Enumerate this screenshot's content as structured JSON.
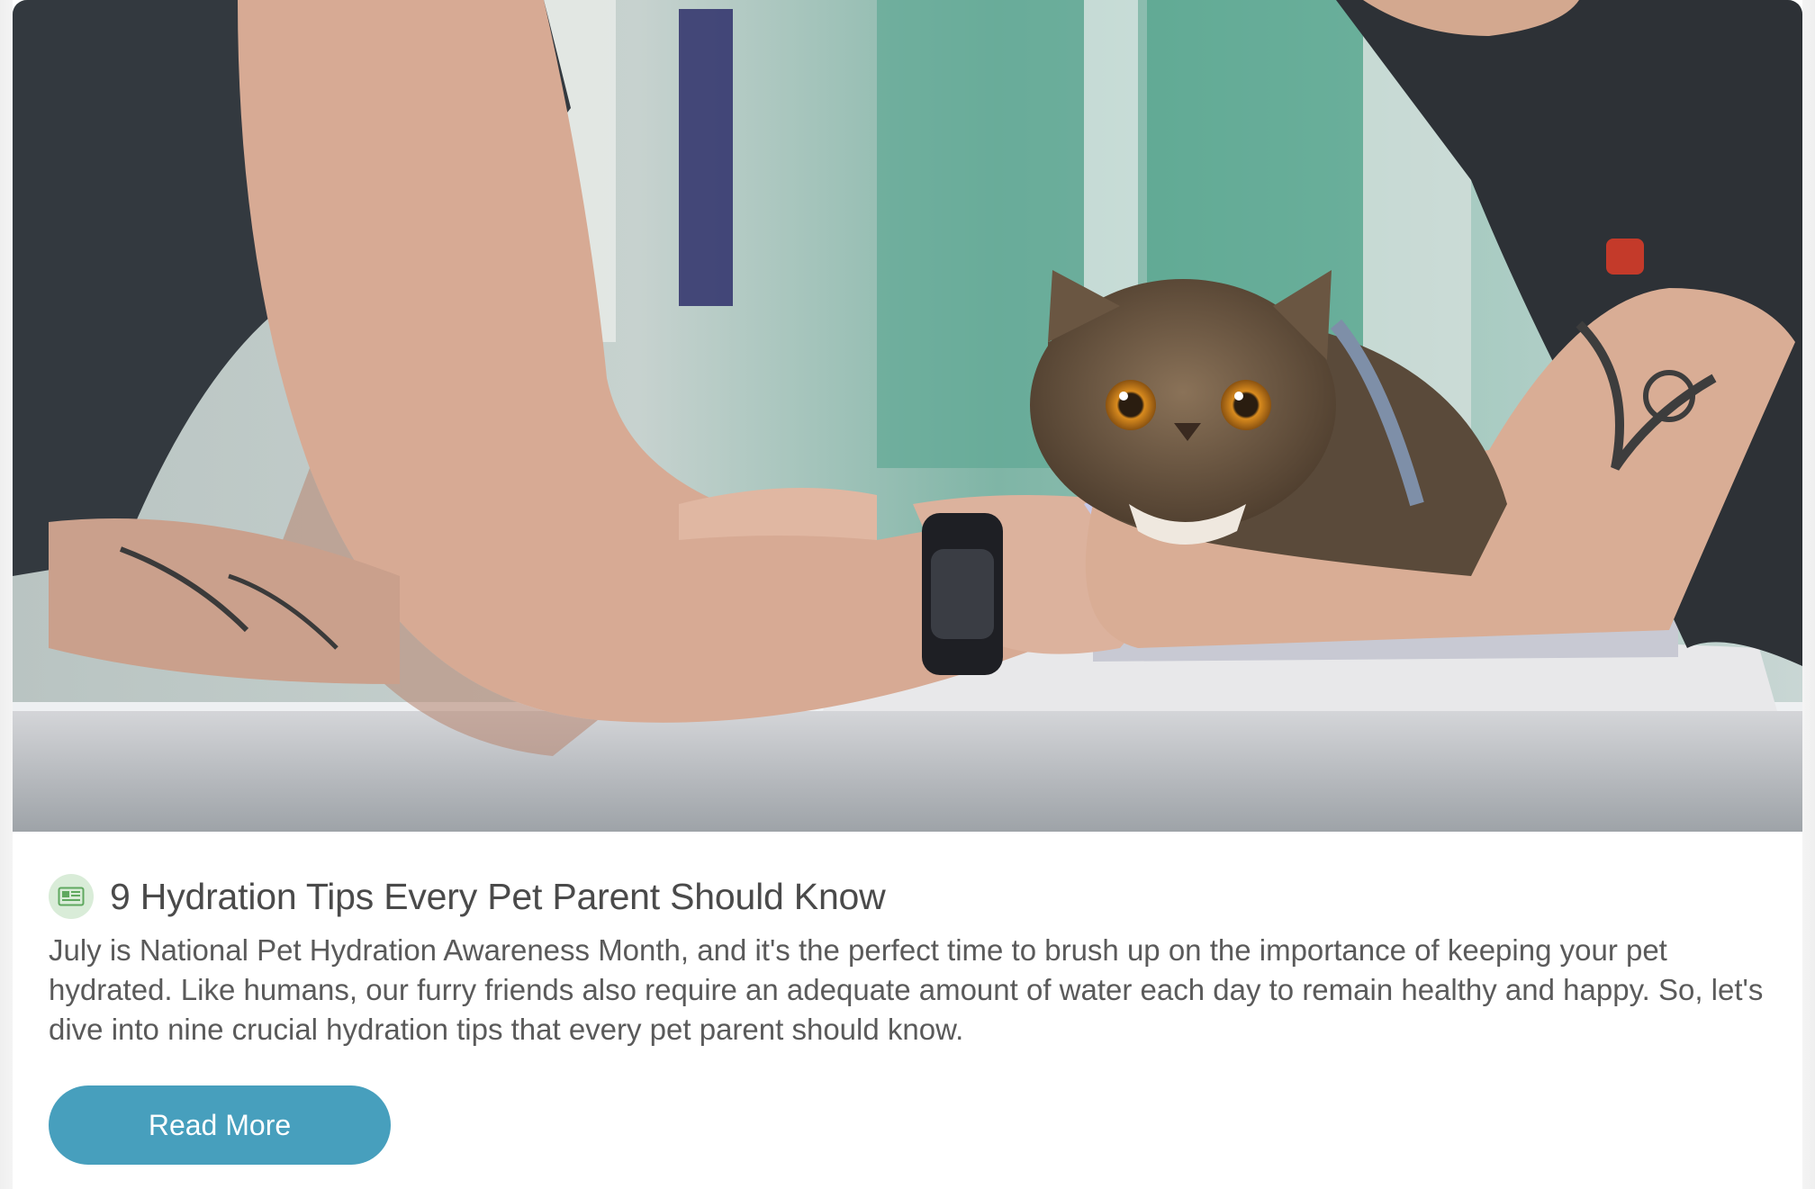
{
  "hero": {
    "image_icon": "photo-vet-cat-icon"
  },
  "article": {
    "type_icon": "newspaper-icon",
    "title": "9 Hydration Tips Every Pet Parent Should Know",
    "excerpt": "July is National Pet Hydration Awareness Month, and it's the perfect time to brush up on the importance of keeping your pet hydrated. Like humans, our furry friends also require an adequate amount of water each day to remain healthy and happy. So, let's dive into nine crucial hydration tips that every pet parent should know.",
    "read_more_label": "Read More"
  },
  "colors": {
    "accent": "#479fbd",
    "icon_bg": "#d9ecd8",
    "icon_fg": "#5fa85f",
    "title_text": "#4a4a4a",
    "body_text": "#5a5a5a"
  }
}
